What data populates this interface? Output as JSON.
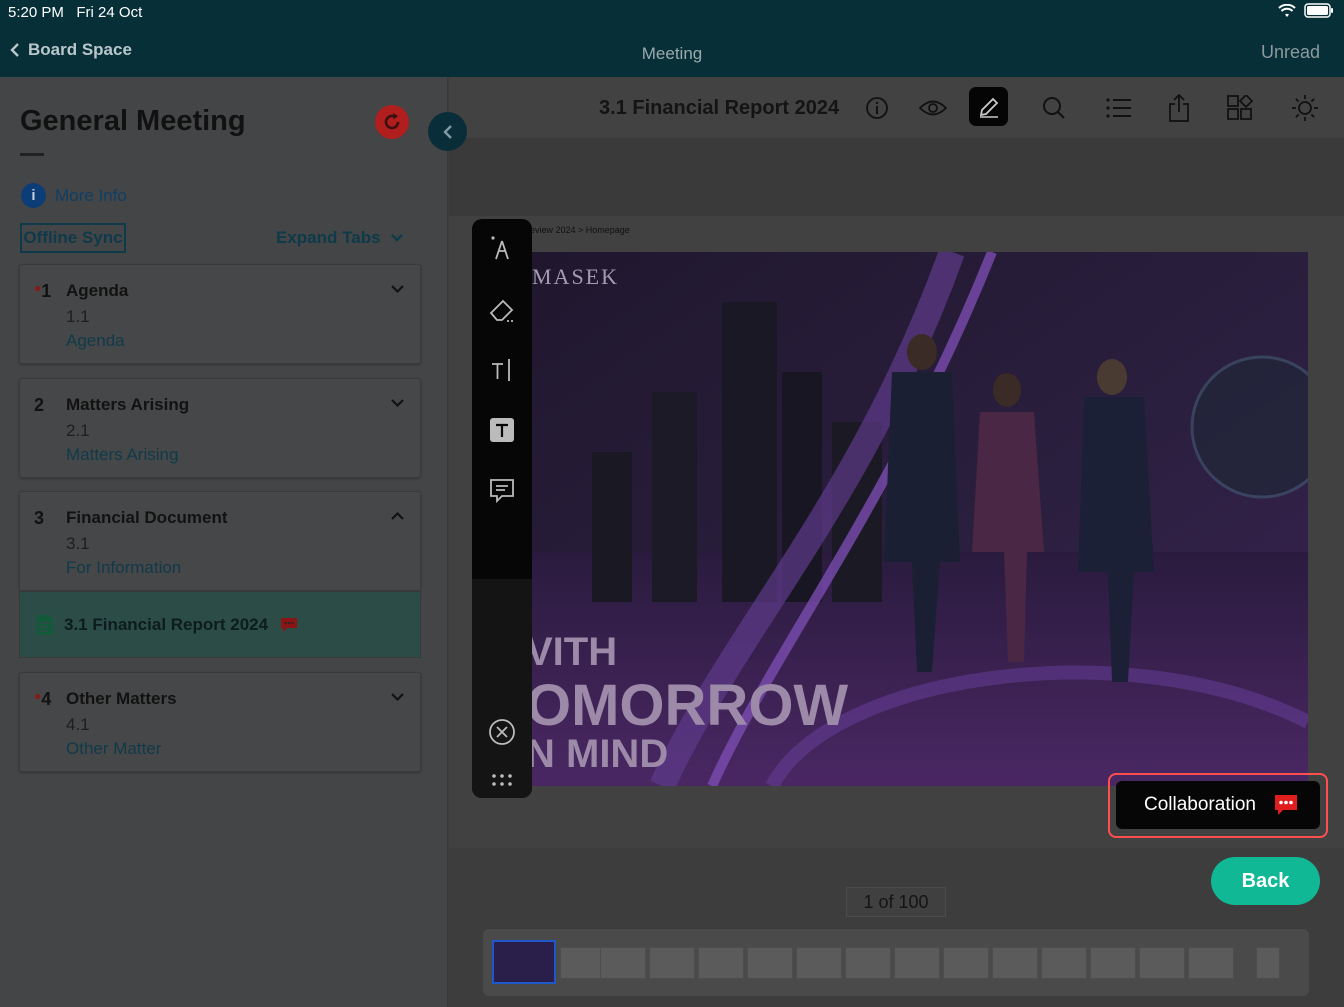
{
  "status": {
    "time": "5:20 PM",
    "date": "Fri 24 Oct"
  },
  "nav": {
    "back_label": "Board Space",
    "title": "Meeting",
    "right_label": "Unread"
  },
  "sidebar": {
    "title": "General Meeting",
    "more_info": "More Info",
    "offline_sync": "Offline Sync",
    "expand_tabs": "Expand Tabs",
    "items": [
      {
        "num": "1",
        "title": "Agenda",
        "sub": "1.1",
        "link": "Agenda",
        "has_dot": true
      },
      {
        "num": "2",
        "title": "Matters Arising",
        "sub": "2.1",
        "link": "Matters Arising",
        "has_dot": false
      },
      {
        "num": "3",
        "title": "Financial Document",
        "sub": "3.1",
        "link": "For Information",
        "has_dot": false
      },
      {
        "num": "4",
        "title": "Other Matters",
        "sub": "4.1",
        "link": "Other Matter",
        "has_dot": true
      }
    ],
    "selected_doc": "3.1 Financial Report 2024"
  },
  "viewer": {
    "doc_title": "3.1 Financial Report 2024",
    "breadcrumb": "eview 2024 > Homepage",
    "slide_logo": "MASEK",
    "slide_lines": [
      "VITH",
      "OMORROW",
      "N MIND"
    ],
    "collab_label": "Collaboration",
    "back_label": "Back",
    "page_count": "1 of 100"
  },
  "colors": {
    "accent": "#10b896",
    "nav_bg": "#072f38",
    "highlight": "#ff4e4e",
    "comment": "#e01e1e"
  }
}
